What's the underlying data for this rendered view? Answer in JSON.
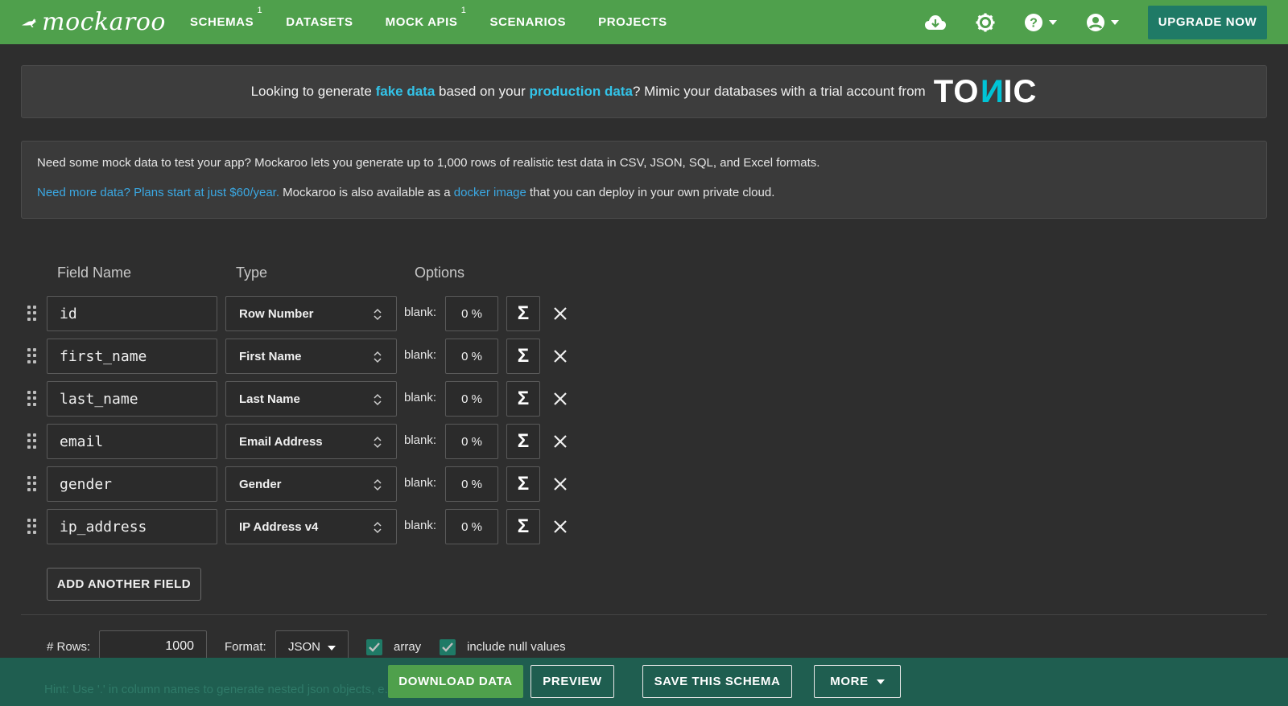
{
  "app": {
    "logo_text": "mockaroo"
  },
  "nav": {
    "items": [
      {
        "label": "SCHEMAS",
        "badge": "1"
      },
      {
        "label": "DATASETS",
        "badge": ""
      },
      {
        "label": "MOCK APIS",
        "badge": "1"
      },
      {
        "label": "SCENARIOS",
        "badge": ""
      },
      {
        "label": "PROJECTS",
        "badge": ""
      }
    ],
    "icons": [
      "cloud-download-icon",
      "settings-gear-icon",
      "help-icon",
      "account-icon"
    ],
    "upgrade_label": "UPGRADE NOW"
  },
  "tonic_banner": {
    "text_1": "Looking to generate ",
    "highlight_1": "fake data",
    "text_2": " based on your ",
    "highlight_2": "production data",
    "text_3": "? Mimic your databases with a trial account from",
    "logo_a": "TO",
    "logo_n": "N",
    "logo_b": "IC"
  },
  "info": {
    "line1": "Need some mock data to test your app? Mockaroo lets you generate up to 1,000 rows of realistic test data in CSV, JSON, SQL, and Excel formats.",
    "line2_link": "Need more data? Plans start at just $60/year.",
    "line2_text": " Mockaroo is also available as a ",
    "line2_link2": "docker image",
    "line2_text2": " that you can deploy in your own private cloud."
  },
  "table": {
    "headers": {
      "field_name": "Field Name",
      "type": "Type",
      "options": "Options"
    },
    "blank_label": "blank:",
    "sigma": "Σ",
    "fields": [
      {
        "name": "id",
        "type": "Row Number",
        "blank": "0 %"
      },
      {
        "name": "first_name",
        "type": "First Name",
        "blank": "0 %"
      },
      {
        "name": "last_name",
        "type": "Last Name",
        "blank": "0 %"
      },
      {
        "name": "email",
        "type": "Email Address",
        "blank": "0 %"
      },
      {
        "name": "gender",
        "type": "Gender",
        "blank": "0 %"
      },
      {
        "name": "ip_address",
        "type": "IP Address v4",
        "blank": "0 %"
      }
    ],
    "add_field_label": "ADD ANOTHER FIELD"
  },
  "options": {
    "rows_label": "# Rows:",
    "rows_value": "1000",
    "format_label": "Format:",
    "format_value": "JSON",
    "array_label": "array",
    "array_checked": true,
    "null_label": "include null values",
    "null_checked": true
  },
  "bottom": {
    "hint": "Hint: Use '.' in column names to generate nested json objects, e.g. 'location.latitude'.",
    "download_label": "DOWNLOAD DATA",
    "preview_label": "PREVIEW",
    "save_label": "SAVE THIS SCHEMA",
    "more_label": "MORE"
  },
  "colors": {
    "nav_green": "#4fa04c",
    "teal": "#1f7a66",
    "bottom_bar": "#1f5e50",
    "link_blue": "#3aa8e3",
    "tonic_cyan": "#00c4d6"
  }
}
